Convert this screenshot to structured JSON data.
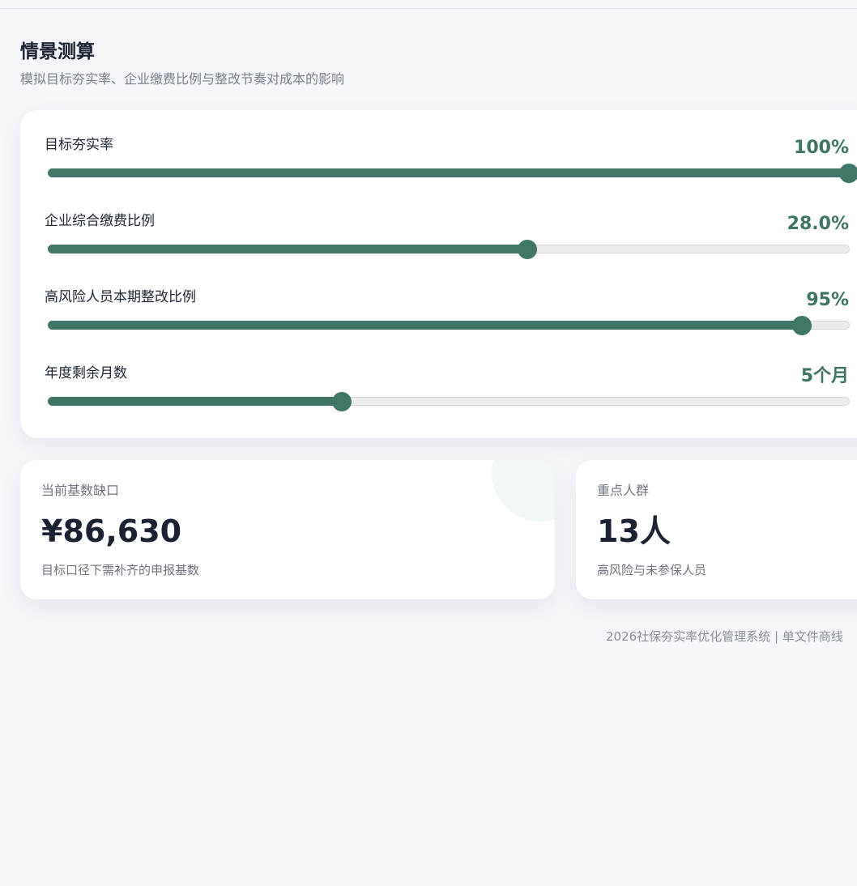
{
  "header": {
    "title": "情景测算",
    "subtitle": "模拟目标夯实率、企业缴费比例与整改节奏对成本的影响"
  },
  "sliders": [
    {
      "label": "目标夯实率",
      "value_text": "100%",
      "fraction": 1.0
    },
    {
      "label": "企业综合缴费比例",
      "value_text": "28.0%",
      "fraction": 0.598
    },
    {
      "label": "高风险人员本期整改比例",
      "value_text": "95%",
      "fraction": 0.941
    },
    {
      "label": "年度剩余月数",
      "value_text": "5个月",
      "fraction": 0.366
    }
  ],
  "cards": {
    "gap": {
      "label": "当前基数缺口",
      "value": "¥86,630",
      "desc": "目标口径下需补齐的申报基数"
    },
    "people": {
      "label": "重点人群",
      "value": "13人",
      "desc": "高风险与未参保人员"
    }
  },
  "footer": {
    "text": "2026社保夯实率优化管理系统 | 单文件商线"
  },
  "colors": {
    "accent": "#3f7667",
    "background": "#f5f6fa",
    "track": "#ececee"
  }
}
